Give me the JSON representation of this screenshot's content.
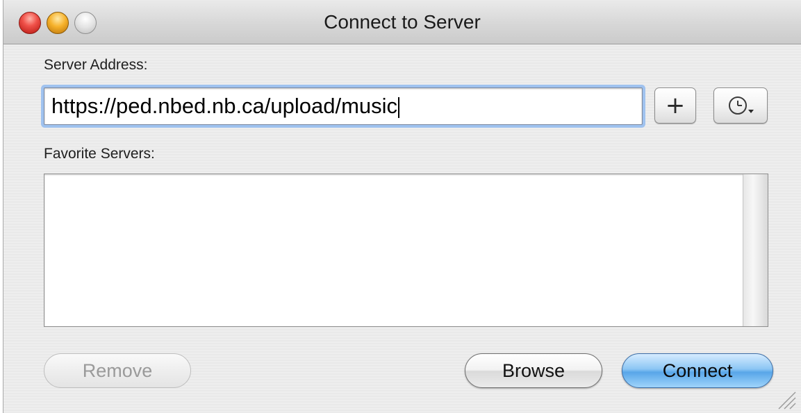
{
  "window": {
    "title": "Connect to Server",
    "controls": [
      "close-button",
      "minimize-button",
      "zoom-button"
    ]
  },
  "server_address": {
    "label": "Server Address:",
    "value": "https://ped.nbed.nb.ca/upload/music"
  },
  "buttons": {
    "add_favorite_icon": "plus-icon",
    "recent_servers_icon": "clock-icon",
    "remove_label": "Remove",
    "browse_label": "Browse",
    "connect_label": "Connect"
  },
  "favorites": {
    "label": "Favorite Servers:",
    "items": []
  },
  "colors": {
    "focus_ring": "#9fc2ef",
    "default_button": "#58a6e8"
  }
}
